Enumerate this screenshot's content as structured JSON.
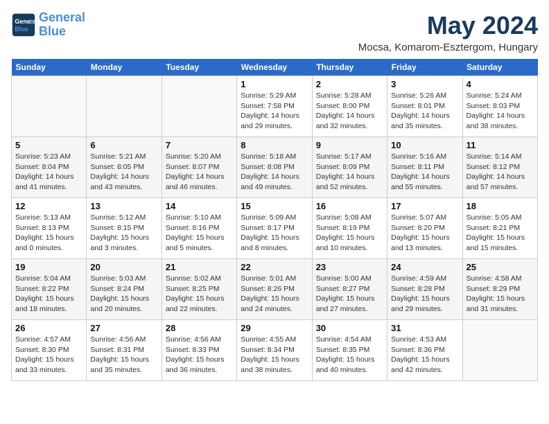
{
  "header": {
    "logo_line1": "General",
    "logo_line2": "Blue",
    "month_year": "May 2024",
    "location": "Mocsa, Komarom-Esztergom, Hungary"
  },
  "weekdays": [
    "Sunday",
    "Monday",
    "Tuesday",
    "Wednesday",
    "Thursday",
    "Friday",
    "Saturday"
  ],
  "weeks": [
    [
      {
        "day": "",
        "info": ""
      },
      {
        "day": "",
        "info": ""
      },
      {
        "day": "",
        "info": ""
      },
      {
        "day": "1",
        "info": "Sunrise: 5:29 AM\nSunset: 7:58 PM\nDaylight: 14 hours\nand 29 minutes."
      },
      {
        "day": "2",
        "info": "Sunrise: 5:28 AM\nSunset: 8:00 PM\nDaylight: 14 hours\nand 32 minutes."
      },
      {
        "day": "3",
        "info": "Sunrise: 5:26 AM\nSunset: 8:01 PM\nDaylight: 14 hours\nand 35 minutes."
      },
      {
        "day": "4",
        "info": "Sunrise: 5:24 AM\nSunset: 8:03 PM\nDaylight: 14 hours\nand 38 minutes."
      }
    ],
    [
      {
        "day": "5",
        "info": "Sunrise: 5:23 AM\nSunset: 8:04 PM\nDaylight: 14 hours\nand 41 minutes."
      },
      {
        "day": "6",
        "info": "Sunrise: 5:21 AM\nSunset: 8:05 PM\nDaylight: 14 hours\nand 43 minutes."
      },
      {
        "day": "7",
        "info": "Sunrise: 5:20 AM\nSunset: 8:07 PM\nDaylight: 14 hours\nand 46 minutes."
      },
      {
        "day": "8",
        "info": "Sunrise: 5:18 AM\nSunset: 8:08 PM\nDaylight: 14 hours\nand 49 minutes."
      },
      {
        "day": "9",
        "info": "Sunrise: 5:17 AM\nSunset: 8:09 PM\nDaylight: 14 hours\nand 52 minutes."
      },
      {
        "day": "10",
        "info": "Sunrise: 5:16 AM\nSunset: 8:11 PM\nDaylight: 14 hours\nand 55 minutes."
      },
      {
        "day": "11",
        "info": "Sunrise: 5:14 AM\nSunset: 8:12 PM\nDaylight: 14 hours\nand 57 minutes."
      }
    ],
    [
      {
        "day": "12",
        "info": "Sunrise: 5:13 AM\nSunset: 8:13 PM\nDaylight: 15 hours\nand 0 minutes."
      },
      {
        "day": "13",
        "info": "Sunrise: 5:12 AM\nSunset: 8:15 PM\nDaylight: 15 hours\nand 3 minutes."
      },
      {
        "day": "14",
        "info": "Sunrise: 5:10 AM\nSunset: 8:16 PM\nDaylight: 15 hours\nand 5 minutes."
      },
      {
        "day": "15",
        "info": "Sunrise: 5:09 AM\nSunset: 8:17 PM\nDaylight: 15 hours\nand 8 minutes."
      },
      {
        "day": "16",
        "info": "Sunrise: 5:08 AM\nSunset: 8:19 PM\nDaylight: 15 hours\nand 10 minutes."
      },
      {
        "day": "17",
        "info": "Sunrise: 5:07 AM\nSunset: 8:20 PM\nDaylight: 15 hours\nand 13 minutes."
      },
      {
        "day": "18",
        "info": "Sunrise: 5:05 AM\nSunset: 8:21 PM\nDaylight: 15 hours\nand 15 minutes."
      }
    ],
    [
      {
        "day": "19",
        "info": "Sunrise: 5:04 AM\nSunset: 8:22 PM\nDaylight: 15 hours\nand 18 minutes."
      },
      {
        "day": "20",
        "info": "Sunrise: 5:03 AM\nSunset: 8:24 PM\nDaylight: 15 hours\nand 20 minutes."
      },
      {
        "day": "21",
        "info": "Sunrise: 5:02 AM\nSunset: 8:25 PM\nDaylight: 15 hours\nand 22 minutes."
      },
      {
        "day": "22",
        "info": "Sunrise: 5:01 AM\nSunset: 8:26 PM\nDaylight: 15 hours\nand 24 minutes."
      },
      {
        "day": "23",
        "info": "Sunrise: 5:00 AM\nSunset: 8:27 PM\nDaylight: 15 hours\nand 27 minutes."
      },
      {
        "day": "24",
        "info": "Sunrise: 4:59 AM\nSunset: 8:28 PM\nDaylight: 15 hours\nand 29 minutes."
      },
      {
        "day": "25",
        "info": "Sunrise: 4:58 AM\nSunset: 8:29 PM\nDaylight: 15 hours\nand 31 minutes."
      }
    ],
    [
      {
        "day": "26",
        "info": "Sunrise: 4:57 AM\nSunset: 8:30 PM\nDaylight: 15 hours\nand 33 minutes."
      },
      {
        "day": "27",
        "info": "Sunrise: 4:56 AM\nSunset: 8:31 PM\nDaylight: 15 hours\nand 35 minutes."
      },
      {
        "day": "28",
        "info": "Sunrise: 4:56 AM\nSunset: 8:33 PM\nDaylight: 15 hours\nand 36 minutes."
      },
      {
        "day": "29",
        "info": "Sunrise: 4:55 AM\nSunset: 8:34 PM\nDaylight: 15 hours\nand 38 minutes."
      },
      {
        "day": "30",
        "info": "Sunrise: 4:54 AM\nSunset: 8:35 PM\nDaylight: 15 hours\nand 40 minutes."
      },
      {
        "day": "31",
        "info": "Sunrise: 4:53 AM\nSunset: 8:36 PM\nDaylight: 15 hours\nand 42 minutes."
      },
      {
        "day": "",
        "info": ""
      }
    ]
  ]
}
